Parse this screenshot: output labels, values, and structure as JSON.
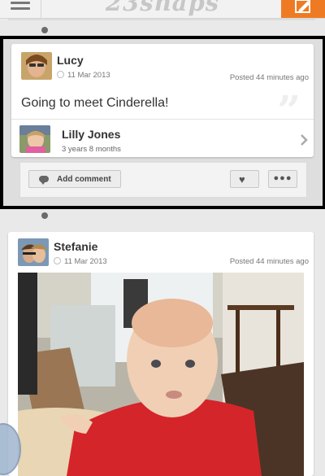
{
  "app": {
    "title": "23snaps"
  },
  "header": {
    "menu_icon": "hamburger-icon",
    "compose_icon": "pencil-edit-icon",
    "compose_color": "#ee7b23"
  },
  "posts": [
    {
      "author": "Lucy",
      "date": "11 Mar 2013",
      "posted": "Posted 44 minutes ago",
      "text": "Going to meet Cinderella!",
      "child": {
        "name": "Lilly Jones",
        "age": "3 years 8 months"
      },
      "actions": {
        "comment_label": "Add comment",
        "like_icon": "heart-icon",
        "more_icon": "more-dots-icon"
      }
    },
    {
      "author": "Stefanie",
      "date": "11 Mar 2013",
      "posted": "Posted 44 minutes ago",
      "photo": "baby-photo"
    }
  ]
}
